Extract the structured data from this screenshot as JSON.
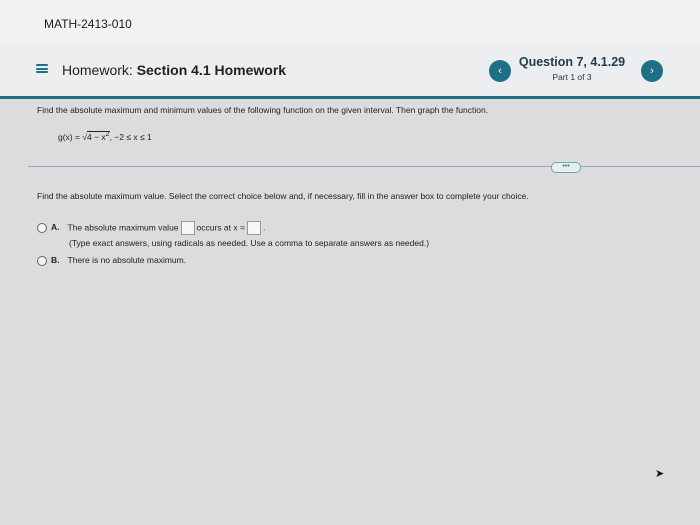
{
  "course": {
    "name": "MATH-2413-010"
  },
  "header": {
    "homework_prefix": "Homework:",
    "homework_title": "Section 4.1 Homework",
    "question_title": "Question 7, 4.1.29",
    "question_part": "Part 1 of 3",
    "prev_icon": "‹",
    "next_icon": "›"
  },
  "problem": {
    "instruction": "Find the absolute maximum and minimum values of the following function on the given interval. Then graph the function.",
    "function_lhs": "g(x) = ",
    "radicand": "4 − x",
    "exponent": "2",
    "interval": ", −2 ≤ x ≤ 1"
  },
  "expand_label": "•••",
  "question": {
    "prompt": "Find the absolute maximum value. Select the correct choice below and, if necessary, fill in the answer box to complete your choice.",
    "choice_a": {
      "letter": "A.",
      "text_before": "The absolute maximum value",
      "text_middle": "occurs at x =",
      "text_after": ".",
      "note": "(Type exact answers, using radicals as needed. Use a comma to separate answers as needed.)"
    },
    "choice_b": {
      "letter": "B.",
      "text": "There is no absolute maximum."
    }
  },
  "colors": {
    "accent": "#1f6f86"
  }
}
